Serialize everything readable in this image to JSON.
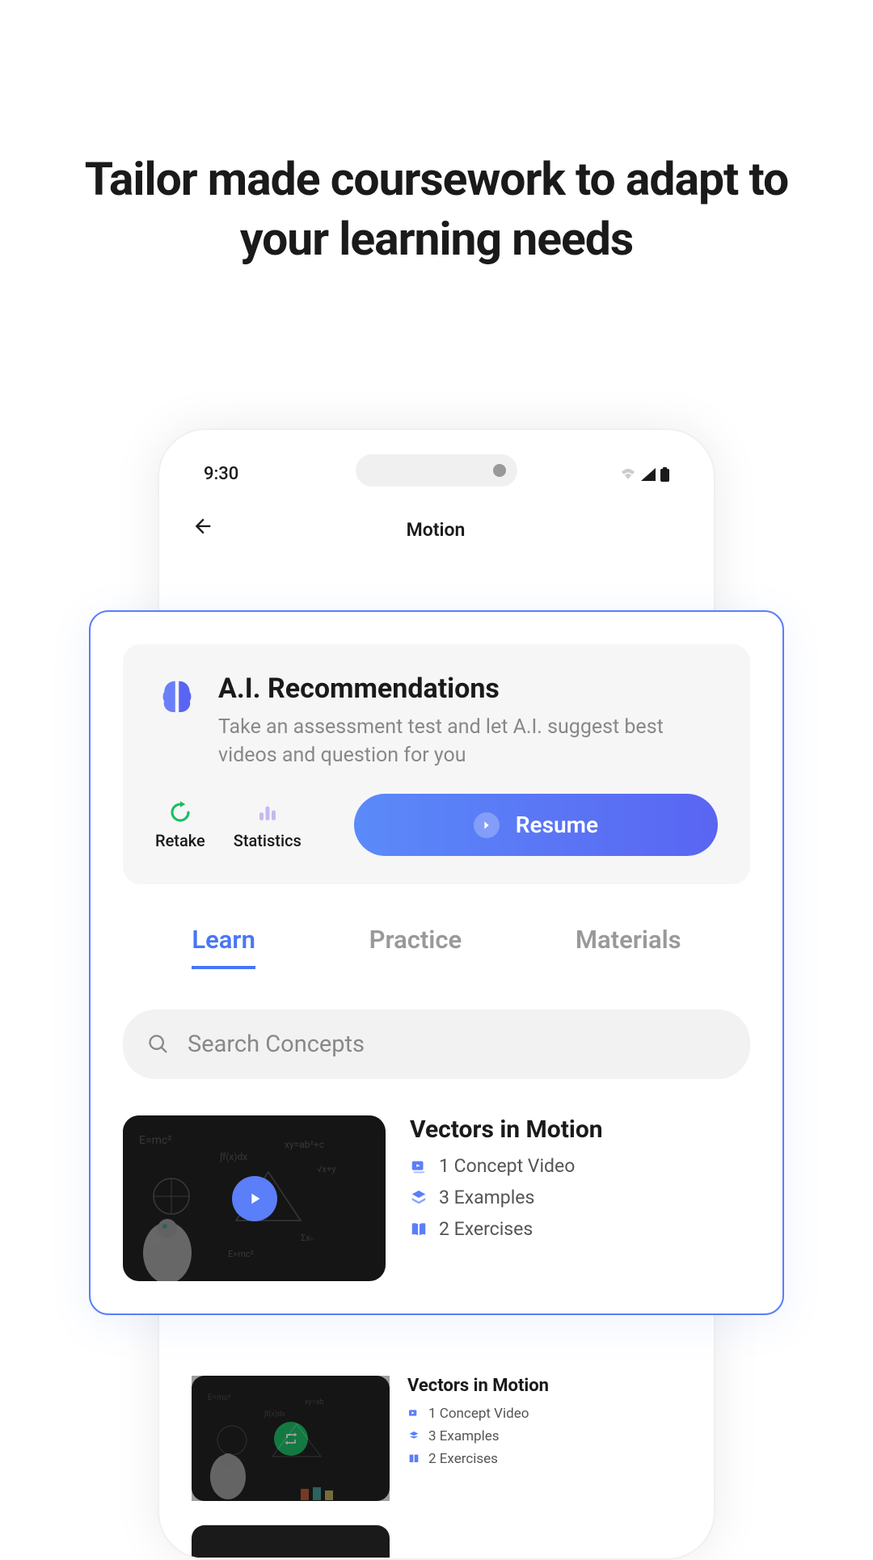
{
  "headline": "Tailor made coursework to adapt to your learning needs",
  "statusBar": {
    "time": "9:30"
  },
  "header": {
    "title": "Motion"
  },
  "aiCard": {
    "title": "A.I. Recommendations",
    "description": "Take an assessment test and let A.I. suggest best videos and question for you",
    "retakeLabel": "Retake",
    "statsLabel": "Statistics",
    "resumeLabel": "Resume"
  },
  "tabs": {
    "learn": "Learn",
    "practice": "Practice",
    "materials": "Materials"
  },
  "search": {
    "placeholder": "Search Concepts"
  },
  "concept1": {
    "title": "Vectors in Motion",
    "videos": "1 Concept Video",
    "examples": "3 Examples",
    "exercises": "2 Exercises"
  },
  "concept2": {
    "title": "Vectors in Motion",
    "videos": "1 Concept Video",
    "examples": "3 Examples",
    "exercises": "2 Exercises"
  }
}
